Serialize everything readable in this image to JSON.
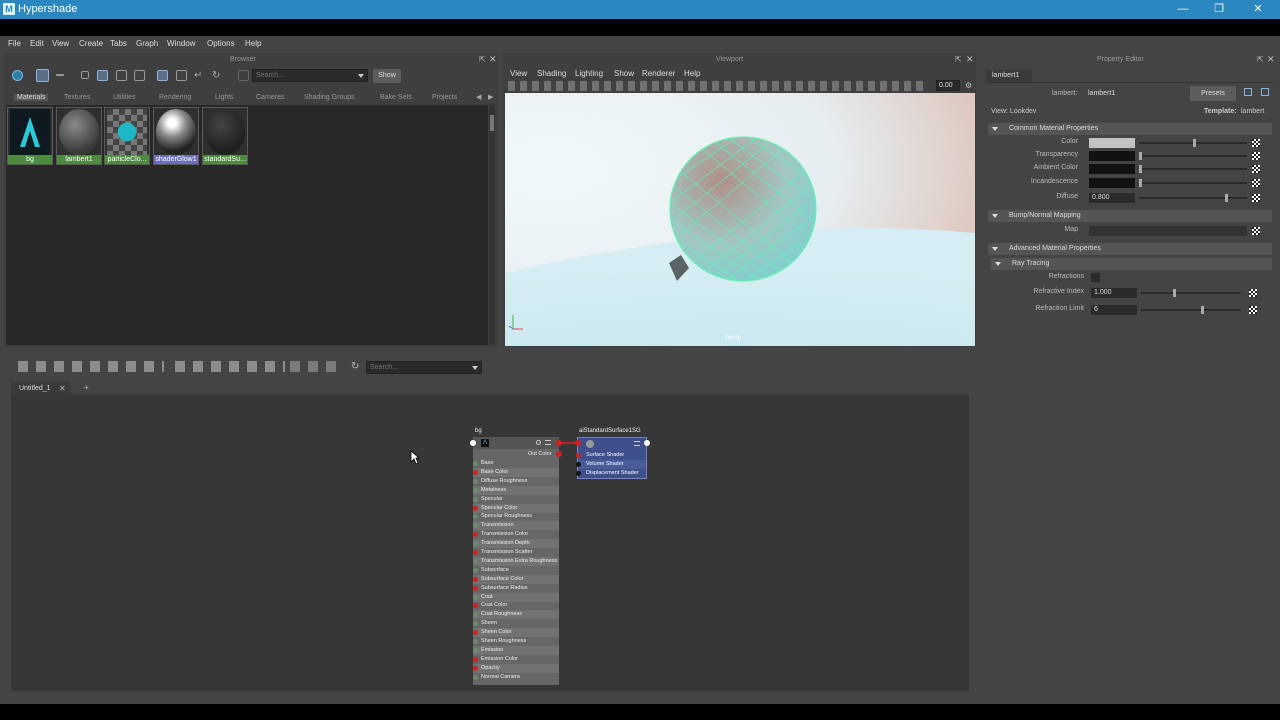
{
  "window": {
    "title": "Hypershade"
  },
  "menu": [
    "File",
    "Edit",
    "View",
    "Create",
    "Tabs",
    "Graph",
    "Window",
    "Options",
    "Help"
  ],
  "browser": {
    "title": "Browser",
    "search_placeholder": "Search...",
    "show_label": "Show",
    "tabs": [
      "Materials",
      "Textures",
      "Utilities",
      "Rendering",
      "Lights",
      "Cameras",
      "Shading Groups",
      "Bake Sets",
      "Projects"
    ],
    "materials": [
      "bg",
      "lambert1",
      "particleClo...",
      "shaderGlow1",
      "standardSu..."
    ]
  },
  "viewport": {
    "title": "Viewport",
    "menu": [
      "View",
      "Shading",
      "Lighting",
      "Show",
      "Renderer",
      "Help"
    ],
    "value": "0.00",
    "camera": "persp"
  },
  "property_editor": {
    "title": "Property Editor",
    "tab": "lambert1",
    "node_label": "lambert:",
    "node_value": "lambert1",
    "presets_label": "Presets",
    "view_label": "View: Lookdev",
    "template_label": "Template:",
    "template_value": "lambert",
    "sections": {
      "common": "Common Material Properties",
      "bump": "Bump/Normal Mapping",
      "advanced": "Advanced Material Properties",
      "ray": "Ray Tracing"
    },
    "attrs": {
      "color": "Color",
      "transparency": "Transparency",
      "ambient": "Ambient Color",
      "incandescence": "Incandescence",
      "diffuse": "Diffuse",
      "diffuse_value": "0.800",
      "map": "Map",
      "refractions": "Refractions",
      "refr_index": "Refractive Index",
      "refr_index_value": "1.000",
      "refr_limit": "Refraction Limit",
      "refr_limit_value": "6"
    },
    "levels": {
      "color": 0.5,
      "diffuse": 0.8,
      "refr_index": 0.32,
      "refr_limit": 0.6
    }
  },
  "node_editor": {
    "search_placeholder": "Search...",
    "tab": "Untitled_1",
    "add_tab": "+",
    "node_bg": {
      "title": "bg",
      "out_label": "Out Color",
      "attrs": [
        "Base",
        "Base Color",
        "Diffuse Roughness",
        "Metalness",
        "Specular",
        "Specular Color",
        "Specular Roughness",
        "Transmission",
        "Transmission Color",
        "Transmission Depth",
        "Transmission Scatter",
        "Transmission Extra Roughness",
        "Subsurface",
        "Subsurface Color",
        "Subsurface Radius",
        "Coat",
        "Coat Color",
        "Coat Roughness",
        "Sheen",
        "Sheen Color",
        "Sheen Roughness",
        "Emission",
        "Emission Color",
        "Opacity",
        "Normal Camera"
      ],
      "red_ports": [
        1,
        5,
        8,
        10,
        13,
        14,
        16,
        19,
        22,
        23
      ]
    },
    "node_sg": {
      "title": "aiStandardSurface1SG",
      "attrs": [
        "Surface Shader",
        "Volume Shader",
        "Displacement Shader"
      ]
    }
  },
  "colors": {
    "titlebar": "#2b87bf",
    "material_label": "#4d8c3f",
    "selected_label": "#6c6cc5",
    "sg_node": "#3e4f8c"
  }
}
